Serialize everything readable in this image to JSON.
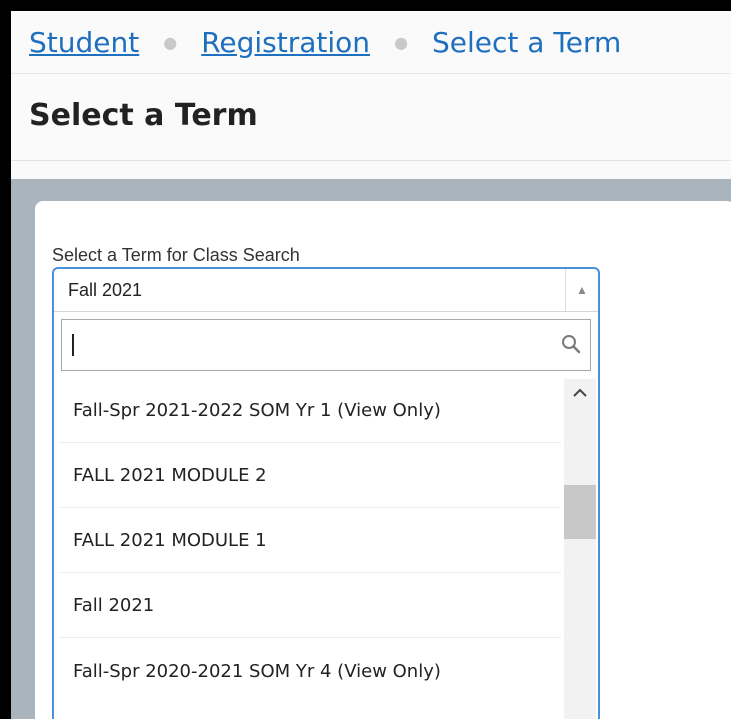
{
  "breadcrumb": {
    "items": [
      "Student",
      "Registration"
    ],
    "current": "Select a Term"
  },
  "page": {
    "title": "Select a Term"
  },
  "term_select": {
    "label": "Select a Term for Class Search",
    "selected_value": "Fall 2021",
    "search_value": "",
    "options": [
      "Fall-Spr 2021-2022 SOM Yr 1 (View Only)",
      "FALL 2021 MODULE 2",
      "FALL 2021 MODULE 1",
      "Fall 2021",
      "Fall-Spr 2020-2021 SOM Yr 4 (View Only)"
    ]
  },
  "colors": {
    "link": "#1f6fbf",
    "focus_border": "#4a90d9",
    "content_background": "#a9b4bd"
  },
  "icons": {
    "open_state": "triangle-up-icon",
    "search": "search-icon",
    "scroll_up": "chevron-up-icon",
    "scroll_down": "chevron-down-icon"
  }
}
